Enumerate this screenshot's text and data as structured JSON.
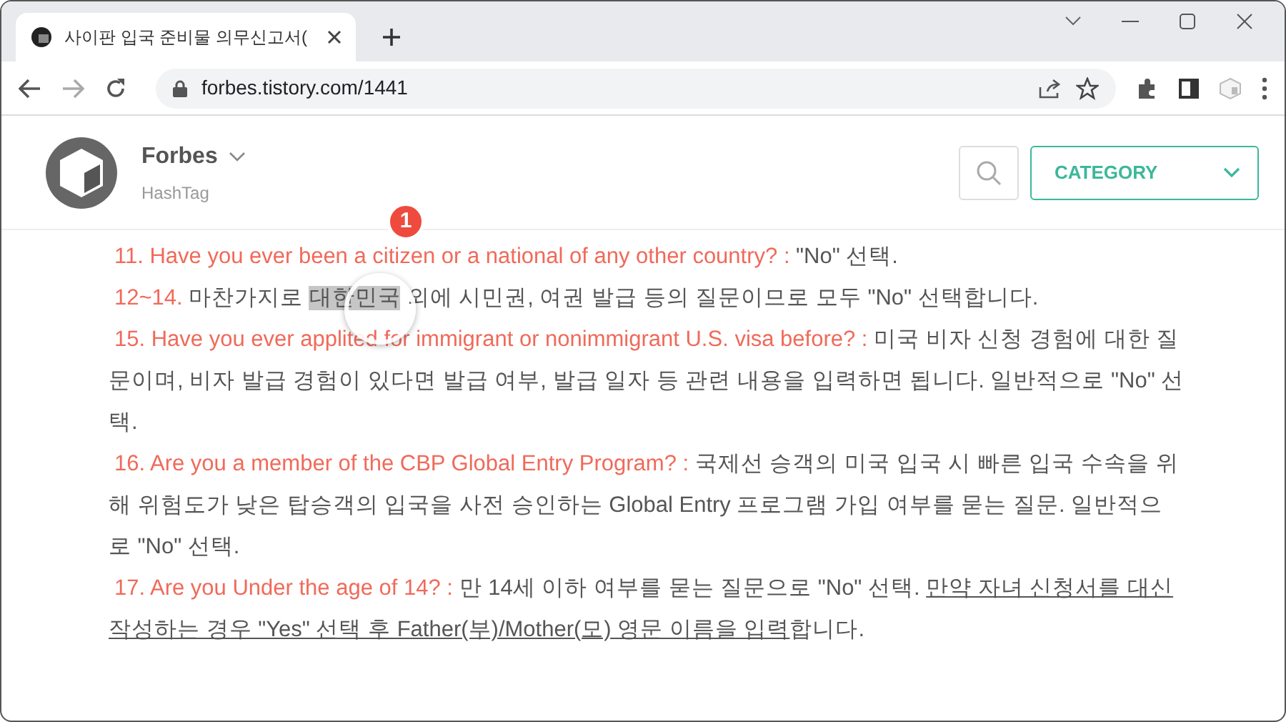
{
  "browser": {
    "tab_title": "사이판 입국 준비물 의무신고서(",
    "url": "forbes.tistory.com/1441"
  },
  "blog_header": {
    "name": "Forbes",
    "subtitle": "HashTag",
    "category_button": "CATEGORY"
  },
  "annotation": {
    "number": "1"
  },
  "paragraphs": [
    {
      "segments": [
        {
          "kind": "label",
          "text": "11. Have you ever been a citizen or a national of any other country? :"
        },
        {
          "kind": "plain",
          "text": " \"No\" 선택."
        }
      ]
    },
    {
      "segments": [
        {
          "kind": "label",
          "text": "12~14."
        },
        {
          "kind": "plain",
          "text": " 마찬가지로 "
        },
        {
          "kind": "selected",
          "text": "대한민국"
        },
        {
          "kind": "plain",
          "text": " 외에 시민권, 여권 발급 등의 질문이므로 모두 \"No\" 선택합니다."
        }
      ]
    },
    {
      "segments": [
        {
          "kind": "label",
          "text": "15. Have you ever applited for immigrant or nonimmigrant U.S. visa before? :"
        },
        {
          "kind": "plain",
          "text": " 미국 비자 신청 경험에 대한 질문이며, 비자 발급 경험이 있다면 발급 여부, 발급 일자 등 관련 내용을 입력하면 됩니다. 일반적으로 \"No\" 선택."
        }
      ]
    },
    {
      "segments": [
        {
          "kind": "label",
          "text": "16. Are you a member of the CBP Global Entry Program? :"
        },
        {
          "kind": "plain",
          "text": " 국제선 승객의 미국 입국 시 빠른 입국 수속을 위해 위험도가 낮은 탑승객의 입국을 사전 승인하는 Global Entry 프로그램 가입 여부를 묻는 질문. 일반적으로 \"No\" 선택."
        }
      ]
    },
    {
      "segments": [
        {
          "kind": "label",
          "text": "17. Are you Under the age of 14? :"
        },
        {
          "kind": "plain",
          "text": " 만 14세 이하 여부를 묻는 질문으로 \"No\" 선택. "
        },
        {
          "kind": "underline",
          "text": "만약 자녀 신청서를 대신 작성하는 경우 \"Yes\" 선택 후 Father(부)/Mother(모) 영문 이름을 입력"
        },
        {
          "kind": "plain",
          "text": "합니다."
        }
      ]
    }
  ]
}
